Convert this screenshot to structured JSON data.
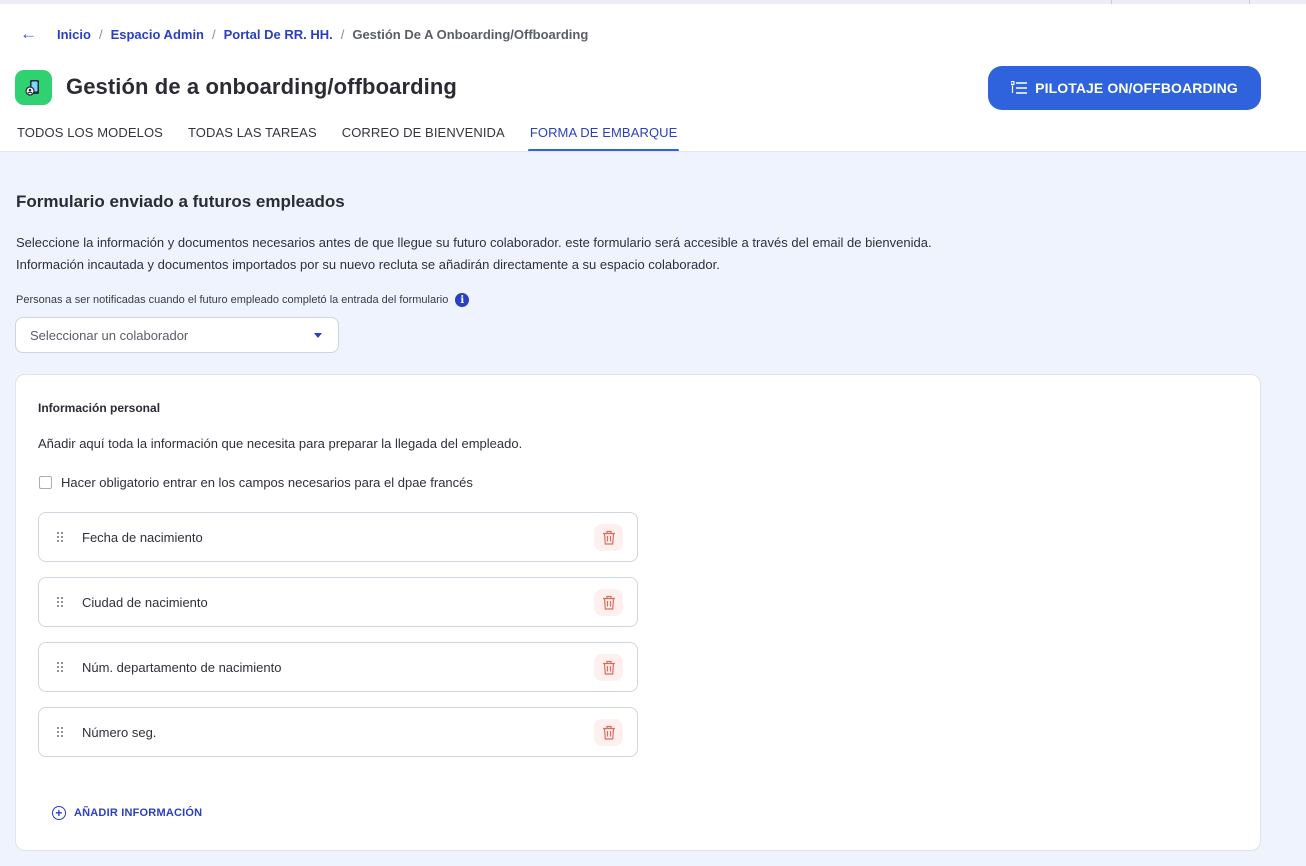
{
  "breadcrumb": {
    "back_icon": "arrow-left-icon",
    "items": [
      "Inicio",
      "Espacio Admin",
      "Portal De RR. HH."
    ],
    "current": "Gestión De A Onboarding/Offboarding"
  },
  "header": {
    "title": "Gestión de a onboarding/offboarding",
    "app_icon": "onboarding-app-icon",
    "app_icon_color": "#2fd171",
    "pilot_button": "PILOTAJE ON/OFFBOARDING"
  },
  "tabs": [
    {
      "label": "TODOS LOS MODELOS",
      "active": false
    },
    {
      "label": "TODAS LAS TAREAS",
      "active": false
    },
    {
      "label": "CORREO DE BIENVENIDA",
      "active": false
    },
    {
      "label": "FORMA DE EMBARQUE",
      "active": true
    }
  ],
  "form": {
    "title": "Formulario enviado a futuros empleados",
    "description_line1": "Seleccione la información y documentos necesarios antes de que llegue su futuro colaborador. este formulario será accesible a través del email de bienvenida.",
    "description_line2": "Información incautada y documentos importados por su nuevo recluta se añadirán directamente a su espacio colaborador.",
    "notify_label": "Personas a ser notificadas cuando el futuro empleado completó la entrada del formulario",
    "notify_placeholder": "Seleccionar un colaborador"
  },
  "personal_info": {
    "title": "Información personal",
    "description": "Añadir aquí toda la información que necesita para preparar la llegada del empleado.",
    "checkbox_label": "Hacer obligatorio entrar en los campos necesarios para el dpae francés",
    "checkbox_checked": false,
    "fields": [
      "Fecha de nacimiento",
      "Ciudad de nacimiento",
      "Núm. departamento de nacimiento",
      "Número seg."
    ],
    "add_button": "AÑADIR INFORMACIÓN"
  },
  "colors": {
    "accent": "#2f63dd",
    "link": "#2a3fc2",
    "background": "#eef3fe",
    "delete_icon": "#e06b5d"
  }
}
